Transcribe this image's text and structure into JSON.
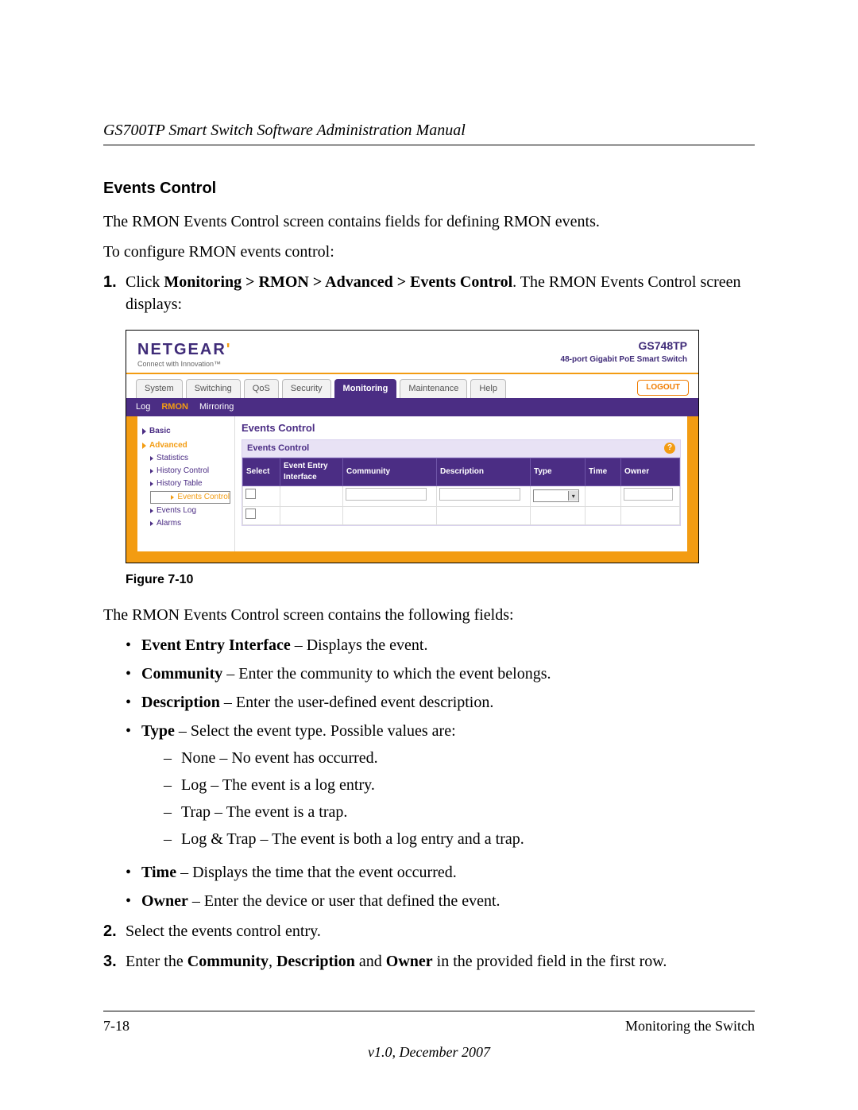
{
  "header": {
    "running": "GS700TP Smart Switch Software Administration Manual"
  },
  "section": {
    "heading": "Events Control"
  },
  "para": {
    "p1": "The RMON Events Control screen contains fields for defining RMON events.",
    "p2": "To configure RMON events control:",
    "p3": "The RMON Events Control screen contains the following fields:"
  },
  "step1": {
    "num": "1.",
    "pre": "Click ",
    "bold": "Monitoring > RMON > Advanced > Events Control",
    "post": ". The RMON Events Control screen displays:"
  },
  "step2": {
    "num": "2.",
    "txt": "Select the events control entry."
  },
  "step3": {
    "num": "3.",
    "pre": "Enter the ",
    "b1": "Community",
    "mid1": ", ",
    "b2": "Description",
    "mid2": " and ",
    "b3": "Owner",
    "post": " in the provided field in the first row."
  },
  "fields": {
    "bullet": "•",
    "eei": {
      "name": "Event Entry Interface",
      "txt": " – Displays the event."
    },
    "community": {
      "name": "Community",
      "txt": " – Enter the community to which the event belongs."
    },
    "description": {
      "name": "Description",
      "txt": " – Enter the user-defined event description."
    },
    "type": {
      "name": "Type",
      "txt": " – Select the event type. Possible values are:",
      "dash": "–",
      "v1": "None – No event has occurred.",
      "v2": "Log – The event is a log entry.",
      "v3": "Trap – The event is a trap.",
      "v4": "Log & Trap – The event is both a log entry and a trap."
    },
    "time": {
      "name": "Time",
      "txt": " – Displays the time that the event occurred."
    },
    "owner": {
      "name": "Owner",
      "txt": " – Enter the device or user that defined the event."
    }
  },
  "figure": {
    "caption": "Figure 7-10",
    "brand": {
      "logo_main": "NETGEAR",
      "logo_dot": "'",
      "tagline": "Connect with Innovation™"
    },
    "product": {
      "model": "GS748TP",
      "desc": "48-port Gigabit PoE Smart Switch"
    },
    "tabs": [
      "System",
      "Switching",
      "QoS",
      "Security",
      "Monitoring",
      "Maintenance",
      "Help"
    ],
    "active_tab": "Monitoring",
    "logout": "LOGOUT",
    "subnav": {
      "items": [
        "Log",
        "RMON",
        "Mirroring"
      ],
      "active": "RMON"
    },
    "side": {
      "basic": "Basic",
      "advanced": "Advanced",
      "links": [
        "Statistics",
        "History Control",
        "History Table",
        "Events Control",
        "Events Log",
        "Alarms"
      ],
      "selected": "Events Control"
    },
    "panel": {
      "title": "Events Control",
      "head": "Events Control",
      "help": "?",
      "cols": [
        "Select",
        "Event Entry Interface",
        "Community",
        "Description",
        "Type",
        "Time",
        "Owner"
      ]
    }
  },
  "footer": {
    "left": "7-18",
    "right": "Monitoring the Switch",
    "version": "v1.0, December 2007"
  }
}
